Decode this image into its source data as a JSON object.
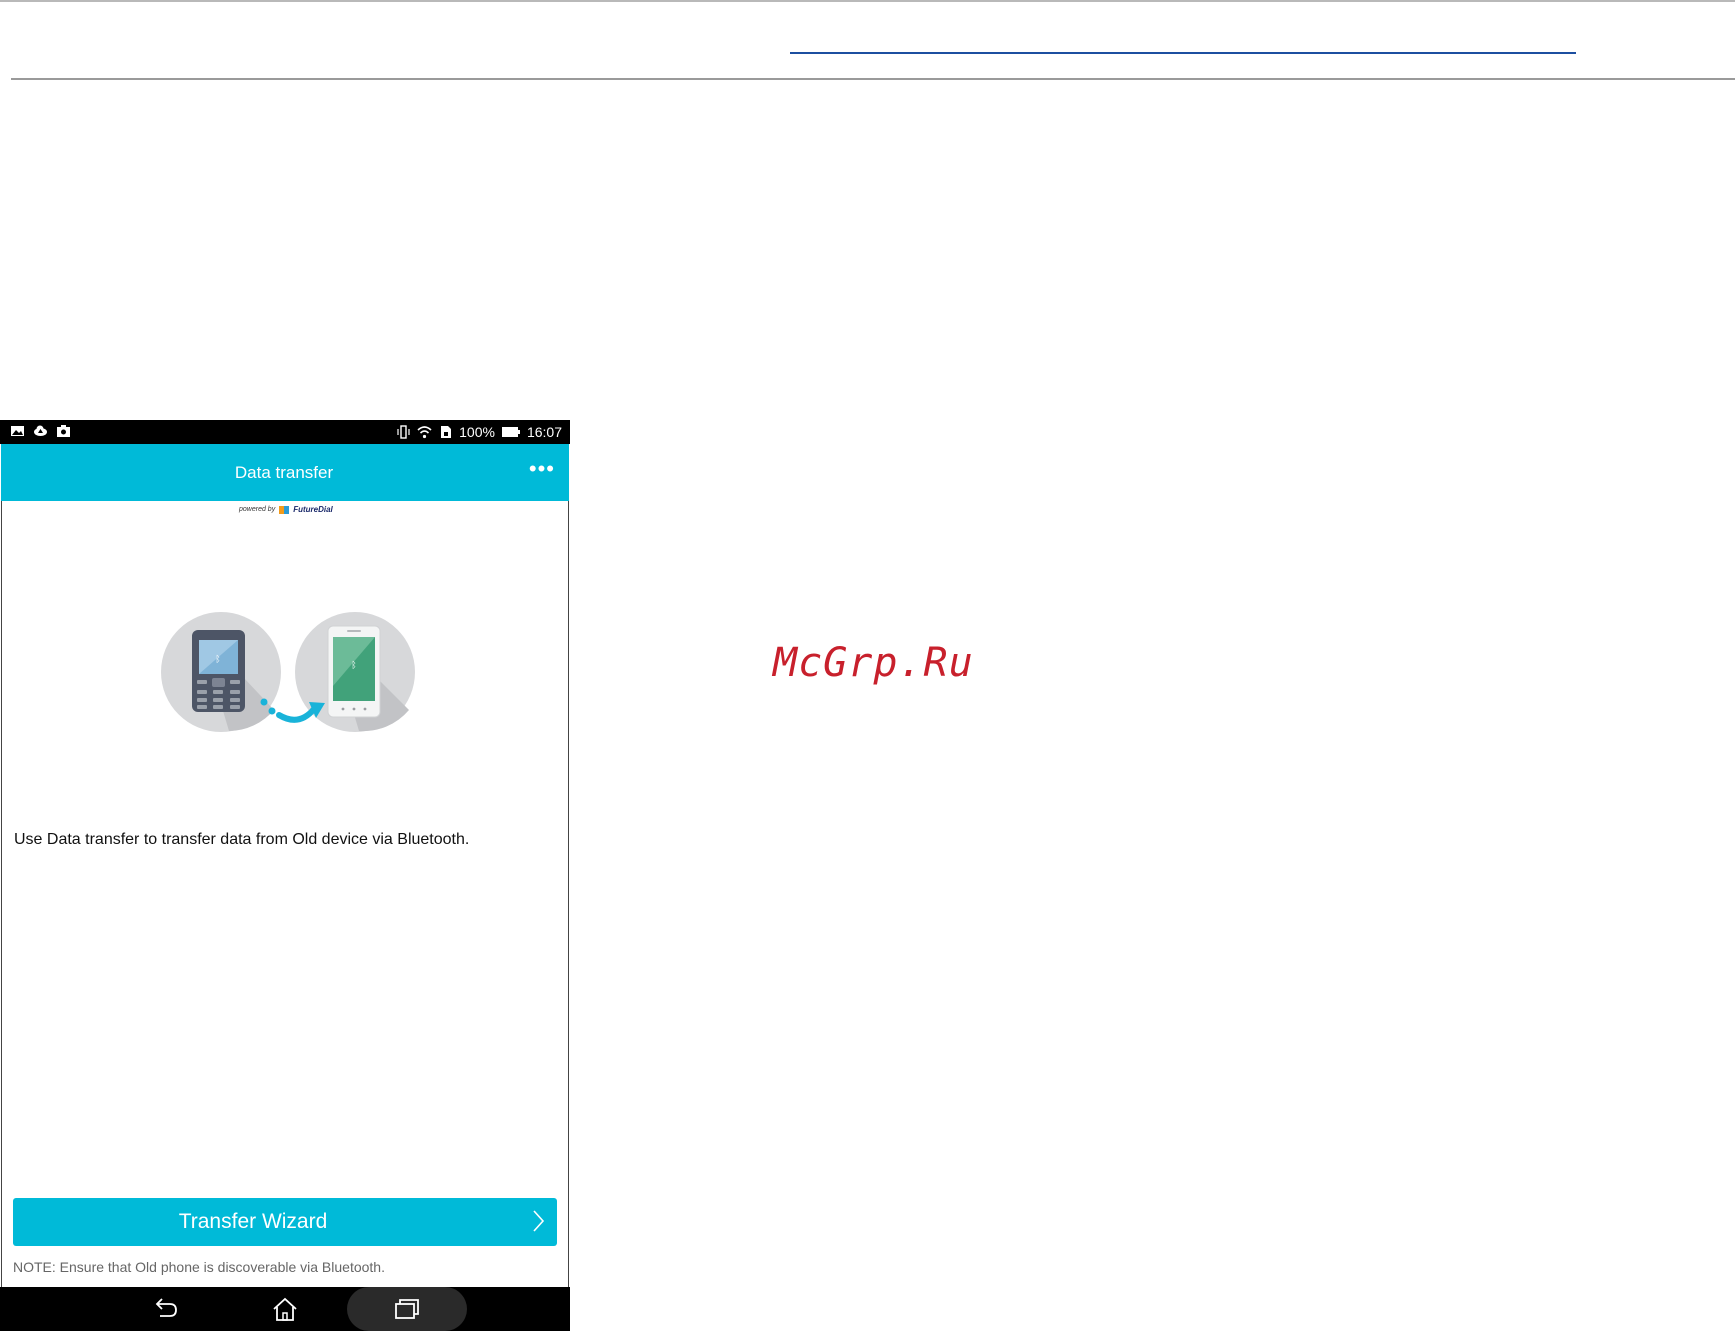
{
  "watermark": "McGrp.Ru",
  "status_bar": {
    "battery_percent": "100%",
    "time": "16:07",
    "left_icons": [
      "gallery-icon",
      "cloud-upload-icon",
      "camera-icon"
    ],
    "right_icons": [
      "vibrate-icon",
      "wifi-icon",
      "sim-icon",
      "battery-icon"
    ]
  },
  "app_bar": {
    "title": "Data transfer",
    "overflow_label": "•••"
  },
  "powered_by": {
    "label": "powered by",
    "brand": "FutureDial"
  },
  "main": {
    "description": "Use Data transfer to transfer data from Old device via Bluetooth.",
    "button_label": "Transfer Wizard",
    "note": "NOTE: Ensure that Old phone is discoverable via Bluetooth."
  },
  "nav_bar": {
    "icons": [
      "back-icon",
      "home-icon",
      "recent-apps-icon"
    ]
  },
  "colors": {
    "accent": "#00bad8",
    "watermark": "#c8202c"
  }
}
